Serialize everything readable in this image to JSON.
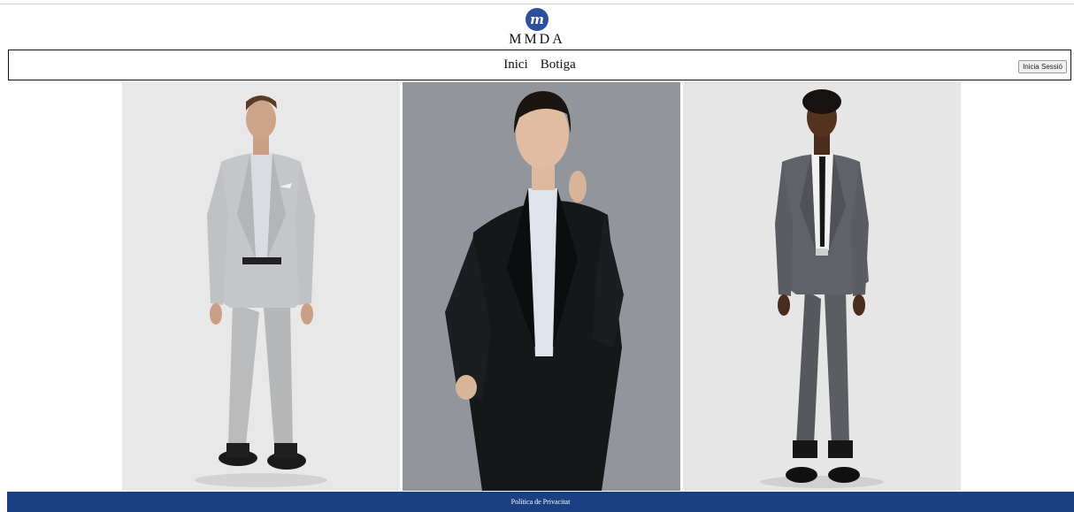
{
  "brand": {
    "logo_glyph": "m",
    "name": "MMDA",
    "logo_color": "#2d4f9e"
  },
  "nav": {
    "items": [
      {
        "label": "Inici"
      },
      {
        "label": "Botiga"
      }
    ],
    "login_label": "Inicia Sessió"
  },
  "gallery": {
    "images": [
      {
        "alt": "Model masculí amb vestit gris clar"
      },
      {
        "alt": "Model femenina amb americana negra"
      },
      {
        "alt": "Model masculí amb vestit gris de quadres i corbata"
      }
    ]
  },
  "footer": {
    "privacy_label": "Política de Privacitat",
    "color": "#1b3f83"
  }
}
